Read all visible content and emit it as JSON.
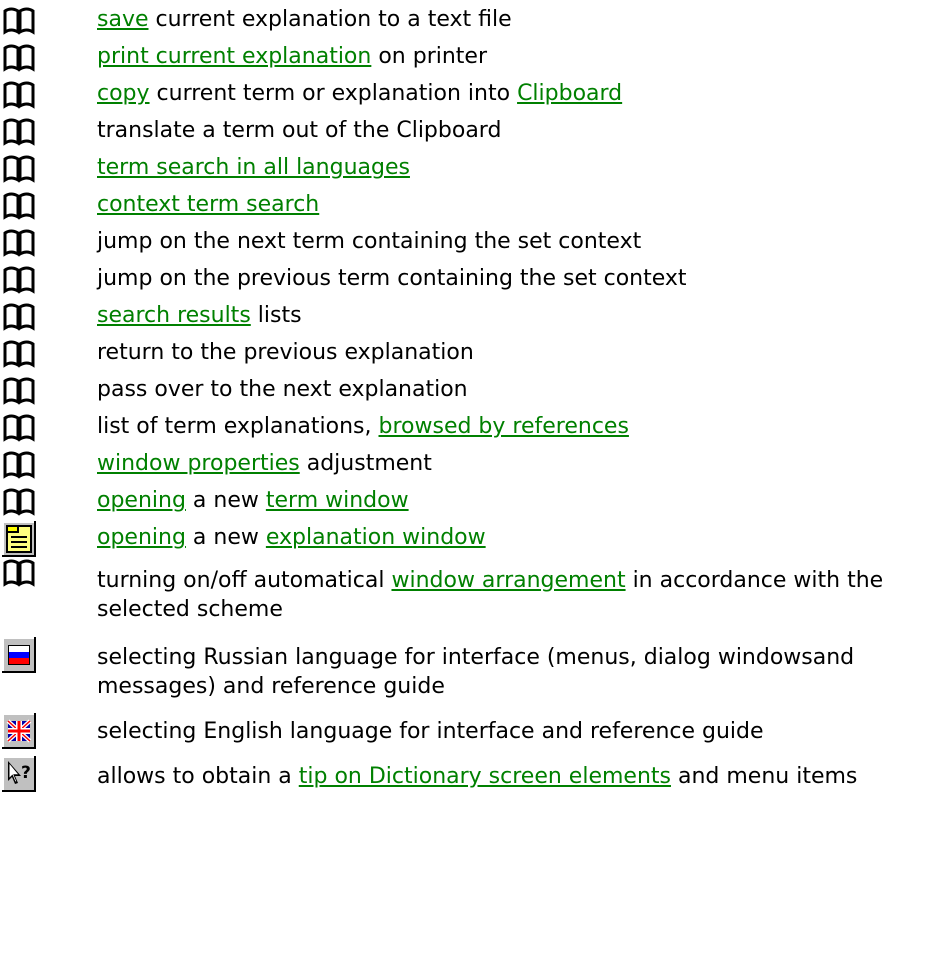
{
  "items": [
    {
      "icon": "book-icon",
      "pre": "",
      "link1": "save",
      "mid": " current explanation to a text file",
      "link2": "",
      "post": ""
    },
    {
      "icon": "book-icon",
      "pre": "",
      "link1": "print current explanation",
      "mid": " on printer",
      "link2": "",
      "post": ""
    },
    {
      "icon": "book-icon",
      "pre": "",
      "link1": "copy",
      "mid": " current term or explanation into ",
      "link2": "Clipboard",
      "post": ""
    },
    {
      "icon": "book-icon",
      "pre": "translate a term out of the Clipboard",
      "link1": "",
      "mid": "",
      "link2": "",
      "post": ""
    },
    {
      "icon": "book-icon",
      "pre": "",
      "link1": "term search in all languages",
      "mid": "",
      "link2": "",
      "post": ""
    },
    {
      "icon": "book-icon",
      "pre": "",
      "link1": "context term search",
      "mid": "",
      "link2": "",
      "post": ""
    },
    {
      "icon": "book-icon",
      "pre": "jump on the next term containing the set context",
      "link1": "",
      "mid": "",
      "link2": "",
      "post": ""
    },
    {
      "icon": "book-icon",
      "pre": "jump on the previous term containing the set context",
      "link1": "",
      "mid": "",
      "link2": "",
      "post": ""
    },
    {
      "icon": "book-icon",
      "pre": "",
      "link1": "search results",
      "mid": " lists",
      "link2": "",
      "post": ""
    },
    {
      "icon": "book-icon",
      "pre": "return to the previous explanation",
      "link1": "",
      "mid": "",
      "link2": "",
      "post": ""
    },
    {
      "icon": "book-icon",
      "pre": "pass over to the next explanation",
      "link1": "",
      "mid": "",
      "link2": "",
      "post": ""
    },
    {
      "icon": "book-icon",
      "pre": "list of term explanations, ",
      "link1": "browsed by references",
      "mid": "",
      "link2": "",
      "post": ""
    },
    {
      "icon": "book-icon",
      "pre": "",
      "link1": "window properties",
      "mid": " adjustment",
      "link2": "",
      "post": ""
    },
    {
      "icon": "book-icon",
      "pre": "",
      "link1": "opening",
      "mid": " a new ",
      "link2": "term window",
      "post": ""
    },
    {
      "icon": "folder-window-icon",
      "pre": "",
      "link1": "opening",
      "mid": " a new ",
      "link2": "explanation window ",
      "post": ""
    },
    {
      "icon": "book-icon",
      "pre": "turning on/off automatical ",
      "link1": "window arrangement",
      "mid": " in accordance with the selected scheme",
      "link2": "",
      "post": ""
    },
    {
      "icon": "russian-flag-icon",
      "pre": "selecting Russian language for interface (menus, dialog windowsand messages) and reference guide",
      "link1": "",
      "mid": "",
      "link2": "",
      "post": ""
    },
    {
      "icon": "british-flag-icon",
      "pre": "selecting English language for interface and reference guide",
      "link1": "",
      "mid": "",
      "link2": "",
      "post": ""
    },
    {
      "icon": "context-help-icon",
      "pre": "allows to obtain a ",
      "link1": "tip on Dictionary screen elements",
      "mid": " and menu items",
      "link2": "",
      "post": ""
    }
  ],
  "colors": {
    "link": "#008000",
    "text": "#000000",
    "background": "#ffffff"
  }
}
